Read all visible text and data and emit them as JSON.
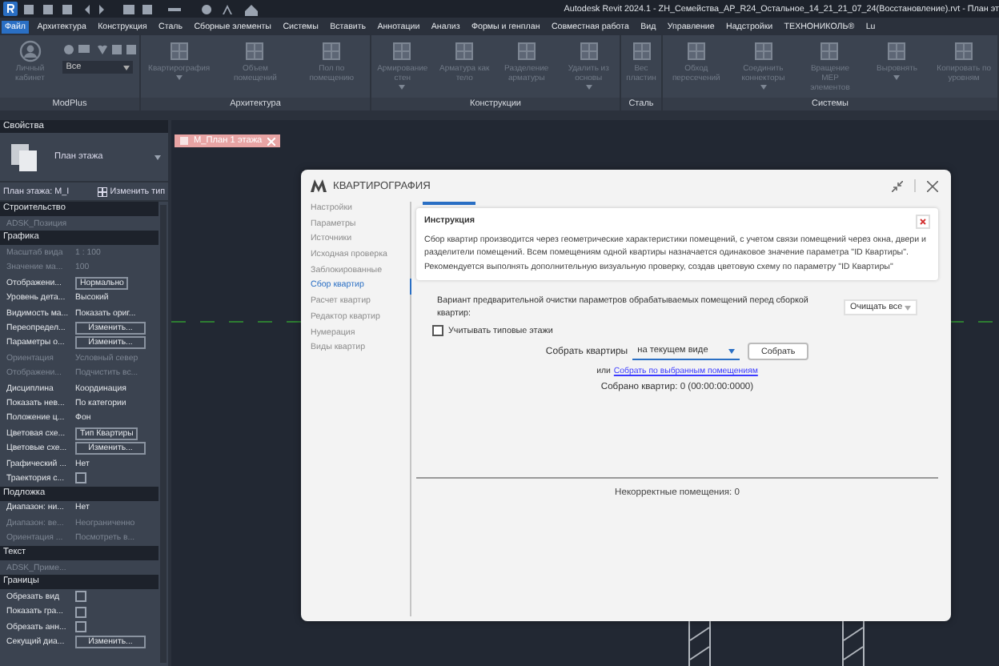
{
  "window": {
    "title": "Autodesk Revit 2024.1 - ZH_Семейства_АР_R24_Остальное_14_21_21_07_24(Восстановление).rvt - План эт"
  },
  "menu": [
    {
      "label": "Файл",
      "selected": true
    },
    {
      "label": "Архитектура",
      "selected": false
    },
    {
      "label": "Конструкция",
      "selected": false
    },
    {
      "label": "Сталь",
      "selected": false
    },
    {
      "label": "Сборные элементы",
      "selected": false
    },
    {
      "label": "Системы",
      "selected": false
    },
    {
      "label": "Вставить",
      "selected": false
    },
    {
      "label": "Аннотации",
      "selected": false
    },
    {
      "label": "Анализ",
      "selected": false
    },
    {
      "label": "Формы и генплан",
      "selected": false
    },
    {
      "label": "Совместная работа",
      "selected": false
    },
    {
      "label": "Вид",
      "selected": false
    },
    {
      "label": "Управление",
      "selected": false
    },
    {
      "label": "Надстройки",
      "selected": false
    },
    {
      "label": "ТЕХНОНИКОЛЬ®",
      "selected": false
    },
    {
      "label": "Lu",
      "selected": false
    }
  ],
  "ribbon": [
    {
      "label": "ModPlus",
      "filter": "Все",
      "tools": [
        {
          "label": "Личный кабинет",
          "kind": "avatar",
          "caret": false
        }
      ]
    },
    {
      "label": "Архитектура",
      "tools": [
        {
          "label": "Квартирография",
          "kind": "tool",
          "caret": true
        },
        {
          "label": "Объем помещений",
          "kind": "tool",
          "caret": false
        },
        {
          "label": "Пол по помещению",
          "kind": "tool",
          "caret": false
        }
      ]
    },
    {
      "label": "Конструкции",
      "tools": [
        {
          "label": "Армирование стен",
          "kind": "tool",
          "caret": true
        },
        {
          "label": "Арматура как тело",
          "kind": "tool",
          "caret": false
        },
        {
          "label": "Разделение арматуры",
          "kind": "tool",
          "caret": false
        },
        {
          "label": "Удалить из основы",
          "kind": "tool",
          "caret": true
        }
      ]
    },
    {
      "label": "Сталь",
      "tools": [
        {
          "label": "Вес пластин",
          "kind": "tool",
          "caret": false
        }
      ]
    },
    {
      "label": "Системы",
      "tools": [
        {
          "label": "Обход пересечений",
          "kind": "tool",
          "caret": false
        },
        {
          "label": "Соединить коннекторы",
          "kind": "tool",
          "caret": true
        },
        {
          "label": "Вращение MEP элементов",
          "kind": "tool",
          "caret": false
        },
        {
          "label": "Выровнять",
          "kind": "tool",
          "caret": true
        },
        {
          "label": "Копировать по уровням",
          "kind": "tool",
          "caret": false
        }
      ]
    }
  ],
  "properties": {
    "title": "Свойства",
    "type_name": "План этажа",
    "instance_selector": "План этажа: M_I",
    "edit_type": "Изменить тип",
    "sections": [
      {
        "title": "Строительство",
        "rows": [
          {
            "kind": "full",
            "name": "ADSK_Позиция",
            "disabled": true
          }
        ]
      },
      {
        "title": "Графика",
        "rows": [
          {
            "kind": "text",
            "name": "Масштаб вида",
            "value": "1 : 100",
            "disabled": true
          },
          {
            "kind": "text",
            "name": "Значение ма...",
            "value": "100",
            "disabled": true
          },
          {
            "kind": "field",
            "name": "Отображени...",
            "value": "Нормально",
            "disabled": false
          },
          {
            "kind": "text",
            "name": "Уровень дета...",
            "value": "Высокий",
            "disabled": false
          },
          {
            "kind": "text",
            "name": "Видимость ма...",
            "value": "Показать ориг...",
            "disabled": false
          },
          {
            "kind": "button",
            "name": "Переопредел...",
            "value": "Изменить...",
            "disabled": false
          },
          {
            "kind": "button",
            "name": "Параметры о...",
            "value": "Изменить...",
            "disabled": false
          },
          {
            "kind": "text",
            "name": "Ориентация",
            "value": "Условный север",
            "disabled": true
          },
          {
            "kind": "text",
            "name": "Отображени...",
            "value": "Подчистить вс...",
            "disabled": true
          },
          {
            "kind": "text",
            "name": "Дисциплина",
            "value": "Координация",
            "disabled": false
          },
          {
            "kind": "text",
            "name": "Показать нев...",
            "value": "По категории",
            "disabled": false
          },
          {
            "kind": "text",
            "name": "Положение ц...",
            "value": "Фон",
            "disabled": false
          },
          {
            "kind": "field",
            "name": "Цветовая схе...",
            "value": "Тип Квартиры",
            "disabled": false
          },
          {
            "kind": "button",
            "name": "Цветовые схе...",
            "value": "Изменить...",
            "disabled": false
          },
          {
            "kind": "text",
            "name": "Графический ...",
            "value": "Нет",
            "disabled": false
          },
          {
            "kind": "checkbox",
            "name": "Траектория с...",
            "checked": false,
            "disabled": false
          }
        ]
      },
      {
        "title": "Подложка",
        "rows": [
          {
            "kind": "text",
            "name": "Диапазон: ни...",
            "value": "Нет",
            "disabled": false
          },
          {
            "kind": "text",
            "name": "Диапазон: ве...",
            "value": "Неограниченно",
            "disabled": true
          },
          {
            "kind": "text",
            "name": "Ориентация ...",
            "value": "Посмотреть в...",
            "disabled": true
          }
        ]
      },
      {
        "title": "Текст",
        "rows": [
          {
            "kind": "full",
            "name": "ADSK_Приме...",
            "disabled": true
          }
        ]
      },
      {
        "title": "Границы",
        "rows": [
          {
            "kind": "checkbox",
            "name": "Обрезать вид",
            "checked": false,
            "disabled": false
          },
          {
            "kind": "checkbox",
            "name": "Показать гра...",
            "checked": false,
            "disabled": false
          },
          {
            "kind": "checkbox",
            "name": "Обрезать анн...",
            "checked": false,
            "disabled": false
          },
          {
            "kind": "button",
            "name": "Секущий диа...",
            "value": "Изменить...",
            "disabled": false
          }
        ]
      }
    ]
  },
  "view_tab": {
    "label": "M_План 1 этажа"
  },
  "dialog": {
    "title": "КВАРТИРОГРАФИЯ",
    "nav": [
      {
        "label": "Настройки",
        "selected": false
      },
      {
        "label": "Параметры",
        "selected": false
      },
      {
        "label": "Источники",
        "selected": false
      },
      {
        "label": "Исходная проверка",
        "selected": false
      },
      {
        "label": "Заблокированные",
        "selected": false
      },
      {
        "label": "Сбор квартир",
        "selected": true
      },
      {
        "label": "Расчет квартир",
        "selected": false
      },
      {
        "label": "Редактор квартир",
        "selected": false
      },
      {
        "label": "Нумерация",
        "selected": false
      },
      {
        "label": "Виды квартир",
        "selected": false
      }
    ],
    "instruction": {
      "title": "Инструкция",
      "text": "Сбор квартир производится через геометрические характеристики помещений, с учетом связи помещений через окна, двери и разделители помещений. Всем помещениям одной квартиры назначается одинаковое значение параметра \"ID Квартиры\". Рекомендуется выполнять дополнительную визуальную проверку, создав цветовую схему по параметру \"ID Квартиры\""
    },
    "cleanup": {
      "label": "Вариант предварительной очистки параметров обрабатываемых помещений перед сборкой квартир:",
      "value": "Очищать все"
    },
    "typical_floors": {
      "label": "Учитывать типовые этажи",
      "checked": false
    },
    "collect": {
      "label": "Собрать квартиры",
      "scope": "на текущем виде",
      "button": "Собрать"
    },
    "alt": {
      "prefix": "или",
      "link": "Собрать по выбранным помещениям"
    },
    "result": "Собрано квартир: 0 (00:00:00:0000)",
    "incorrect": "Некорректные помещения: 0"
  }
}
